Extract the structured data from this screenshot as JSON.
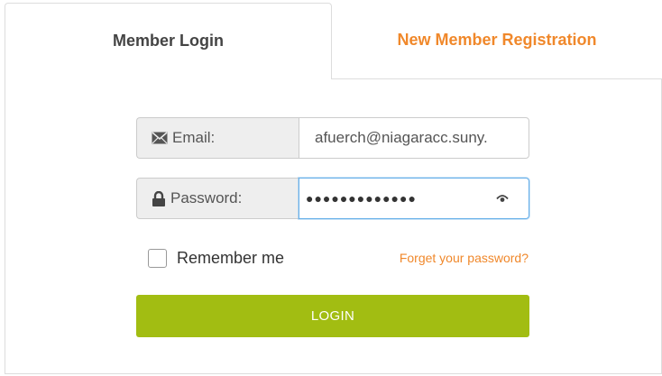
{
  "tabs": {
    "login_label": "Member Login",
    "register_label": "New Member Registration"
  },
  "form": {
    "email_label": "Email:",
    "email_value": "afuerch@niagaracc.suny.",
    "password_label": "Password:",
    "password_value_masked": "●●●●●●●●●●●●●",
    "remember_label": "Remember me",
    "remember_checked": false,
    "forgot_label": "Forget your password?",
    "login_label": "LOGIN"
  },
  "icons": {
    "email": "envelope-icon",
    "password": "lock-icon",
    "reveal": "eye-icon"
  },
  "colors": {
    "accent_orange": "#f0882b",
    "login_green": "#a2bd12",
    "focus_blue": "#66afe9"
  }
}
